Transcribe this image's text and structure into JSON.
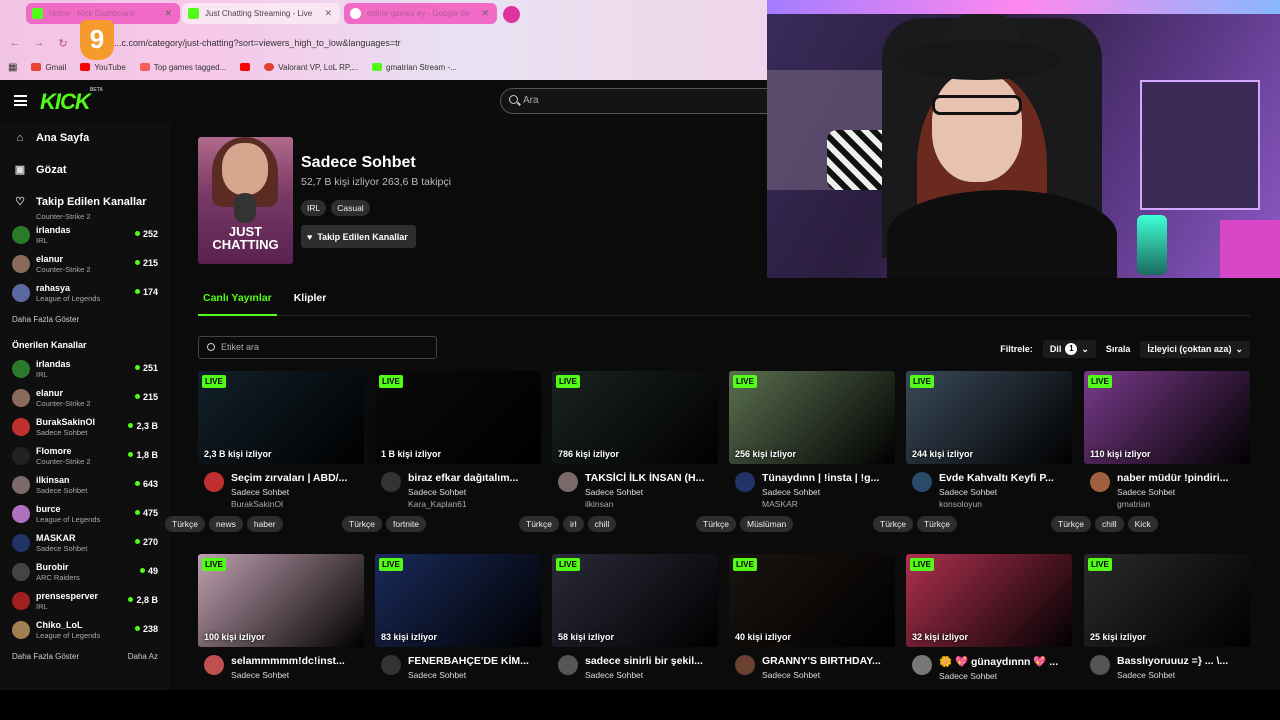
{
  "browser": {
    "tabs": [
      {
        "label": "Home - Kick Dashboard",
        "color": "#f06ac6"
      },
      {
        "label": "Just Chatting Streaming - Live",
        "color": "#fbe6f4"
      },
      {
        "label": "online games ey - Google de",
        "color": "#f06ac6"
      }
    ],
    "url": "...c.com/category/just-chatting?sort=viewers_high_to_low&languages=tr",
    "badge": "9",
    "bookmarks": [
      {
        "label": "Gmail",
        "icon": "gmail-icon",
        "color": "#ea4335"
      },
      {
        "label": "YouTube",
        "icon": "youtube-icon",
        "color": "#ff0000"
      },
      {
        "label": "Top games tagged...",
        "icon": "itch-icon",
        "color": "#fa5c5c"
      },
      {
        "label": "",
        "icon": "youtube-icon",
        "color": "#ff0000"
      },
      {
        "label": "Valorant VP, LoL RP,...",
        "icon": "codashop-icon",
        "color": "#e23b2f"
      },
      {
        "label": "gmatrian Stream -...",
        "icon": "kick-icon",
        "color": "#53fc18"
      }
    ]
  },
  "header": {
    "logo": "KICK",
    "beta": "BETA",
    "search_placeholder": "Ara"
  },
  "sidebar": {
    "nav": [
      {
        "label": "Ana Sayfa",
        "icon": "home-icon"
      },
      {
        "label": "Gözat",
        "icon": "browse-icon"
      },
      {
        "label": "Takip Edilen Kanallar",
        "icon": "heart-icon"
      }
    ],
    "followed_partial": "Counter-Strike 2",
    "followed": [
      {
        "name": "irlandas",
        "game": "IRL",
        "viewers": "252",
        "color": "#2a7a2a"
      },
      {
        "name": "elanur",
        "game": "Counter-Strike 2",
        "viewers": "215",
        "color": "#8a6a5a"
      },
      {
        "name": "rahasya",
        "game": "League of Legends",
        "viewers": "174",
        "color": "#5a6aa0"
      }
    ],
    "show_more": "Daha Fazla Göster",
    "recommended_title": "Önerilen Kanallar",
    "recommended": [
      {
        "name": "irlandas",
        "game": "IRL",
        "viewers": "251",
        "color": "#2a7a2a"
      },
      {
        "name": "elanur",
        "game": "Counter-Strike 2",
        "viewers": "215",
        "color": "#8a6a5a"
      },
      {
        "name": "BurakSakinOl",
        "game": "Sadece Sohbet",
        "viewers": "2,3 B",
        "color": "#c03030"
      },
      {
        "name": "Flomore",
        "game": "Counter-Strike 2",
        "viewers": "1,8 B",
        "color": "#222222"
      },
      {
        "name": "ilkinsan",
        "game": "Sadece Sohbet",
        "viewers": "643",
        "color": "#7a6a6a"
      },
      {
        "name": "burce",
        "game": "League of Legends",
        "viewers": "475",
        "color": "#b070c0"
      },
      {
        "name": "MASKAR",
        "game": "Sadece Sohbet",
        "viewers": "270",
        "color": "#223366"
      },
      {
        "name": "Burobir",
        "game": "ARC Raiders",
        "viewers": "49",
        "color": "#444444"
      },
      {
        "name": "prensesperver",
        "game": "IRL",
        "viewers": "2,8 B",
        "color": "#a02020"
      },
      {
        "name": "Chiko_LoL",
        "game": "League of Legends",
        "viewers": "238",
        "color": "#a08050"
      }
    ],
    "show_more2": "Daha Fazla Göster",
    "show_less": "Daha Az"
  },
  "category": {
    "cover_text": "JUST CHATTING",
    "title": "Sadece Sohbet",
    "stats": "52,7 B kişi izliyor  263,6 B takipçi",
    "tags": [
      "IRL",
      "Casual"
    ],
    "follow_label": "Takip Edilen Kanallar"
  },
  "tabs": [
    {
      "label": "Canlı Yayınlar",
      "active": true
    },
    {
      "label": "Klipler",
      "active": false
    }
  ],
  "tag_search_placeholder": "Etiket ara",
  "filters": {
    "filter_label": "Filtrele:",
    "lang_label": "Dil",
    "lang_count": "1",
    "sort_label": "Sırala",
    "sort_value": "İzleyici (çoktan aza)"
  },
  "live_badge": "LIVE",
  "streams_row1": [
    {
      "viewers": "2,3 B kişi izliyor",
      "title": "Seçim zırvaları | ABD/...",
      "category": "Sadece Sohbet",
      "user": "BurakSakinOl",
      "tags": [
        "Türkçe",
        "news",
        "haber"
      ],
      "thumb": "#12202a",
      "av": "#c03030"
    },
    {
      "viewers": "1 B kişi izliyor",
      "title": "biraz efkar dağıtalım...",
      "category": "Sadece Sohbet",
      "user": "Kara_Kaplan61",
      "tags": [
        "Türkçe",
        "fortnite"
      ],
      "thumb": "#0a0a0a",
      "av": "#333333"
    },
    {
      "viewers": "786 kişi izliyor",
      "title": "TAKSİCİ İLK İNSAN (H...",
      "category": "Sadece Sohbet",
      "user": "ilkinsan",
      "tags": [
        "Türkçe",
        "irl",
        "chill"
      ],
      "thumb": "#1a2320",
      "av": "#7a6a6a"
    },
    {
      "viewers": "256 kişi izliyor",
      "title": "Tünaydınn | !insta | !g...",
      "category": "Sadece Sohbet",
      "user": "MASKAR",
      "tags": [
        "Türkçe",
        "Müslüman"
      ],
      "thumb": "#5a7050",
      "av": "#223366"
    },
    {
      "viewers": "244 kişi izliyor",
      "title": "Evde Kahvaltı Keyfi P...",
      "category": "Sadece Sohbet",
      "user": "konsoloyun",
      "tags": [
        "Türkçe",
        "Türkçe"
      ],
      "thumb": "#3a4a5a",
      "av": "#2a4a6a"
    },
    {
      "viewers": "110 kişi izliyor",
      "title": "naber müdür !pindiri...",
      "category": "Sadece Sohbet",
      "user": "gmatrian",
      "tags": [
        "Türkçe",
        "chill",
        "Kick"
      ],
      "thumb": "#7a3a8a",
      "av": "#a06040"
    }
  ],
  "streams_row2": [
    {
      "viewers": "100 kişi izliyor",
      "title": "selammmmm!dc!inst...",
      "category": "Sadece Sohbet",
      "thumb": "#c0a0b0",
      "av": "#c05050"
    },
    {
      "viewers": "83 kişi izliyor",
      "title": "FENERBAHÇE'DE KİM...",
      "category": "Sadece Sohbet",
      "thumb": "#1a2a5a",
      "av": "#333333"
    },
    {
      "viewers": "58 kişi izliyor",
      "title": "sadece sinirli bir şekil...",
      "category": "Sadece Sohbet",
      "thumb": "#2a2a3a",
      "av": "#555555"
    },
    {
      "viewers": "40 kişi izliyor",
      "title": "GRANNY'S BIRTHDAY...",
      "category": "Sadece Sohbet",
      "thumb": "#1a1410",
      "av": "#6a4030"
    },
    {
      "viewers": "32 kişi izliyor",
      "title": "🌼 💖 günaydınnn 💖 ...",
      "category": "Sadece Sohbet",
      "thumb": "#b03050",
      "av": "#777777"
    },
    {
      "viewers": "25 kişi izliyor",
      "title": "Basslıyoruuuz =} ... \\...",
      "category": "Sadece Sohbet",
      "thumb": "#2a2a2a",
      "av": "#555555"
    }
  ]
}
